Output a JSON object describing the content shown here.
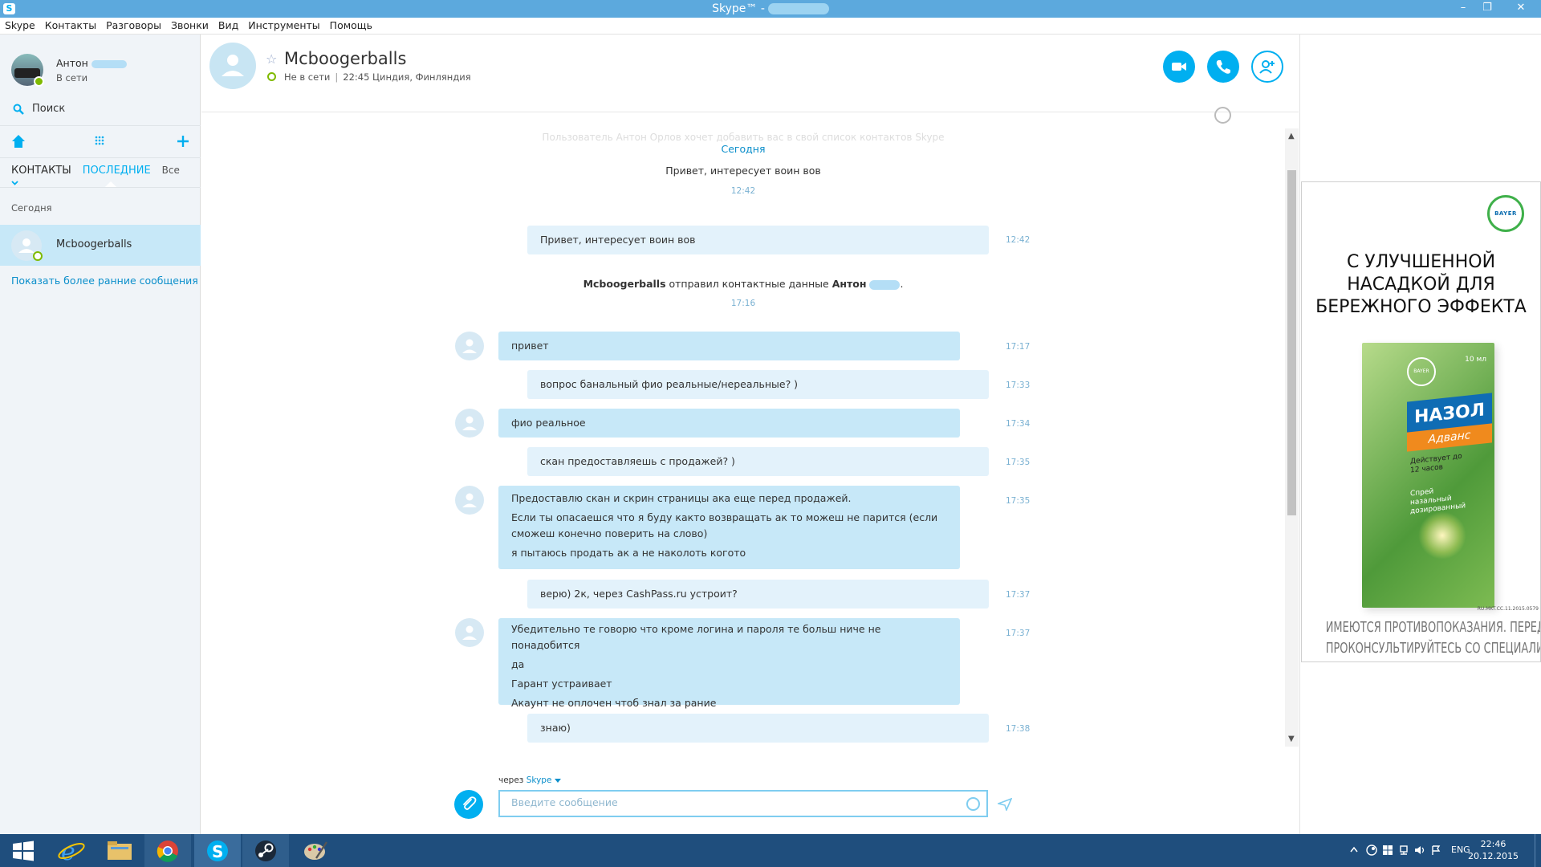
{
  "window": {
    "title": "Skype™ -",
    "app_icon": "skype-icon",
    "minimize": "–",
    "restore": "❐",
    "close": "✕"
  },
  "menu": [
    "Skype",
    "Контакты",
    "Разговоры",
    "Звонки",
    "Вид",
    "Инструменты",
    "Помощь"
  ],
  "profile": {
    "name": "Антон",
    "status": "В сети"
  },
  "search": {
    "label": "Поиск"
  },
  "tabs": {
    "contacts": "КОНТАКТЫ",
    "recent": "ПОСЛЕДНИЕ",
    "filter": "Все"
  },
  "recent": {
    "section": "Сегодня",
    "contact": "Mcboogerballs",
    "show_more": "Показать более ранние сообщения"
  },
  "conversation": {
    "title": "Mcboogerballs",
    "status": "Не в сети",
    "local_info": "22:45 Циндия, Финляндия",
    "faded_notice": "Пользователь Антон Орлов хочет добавить вас в свой список контактов Skype",
    "day": "Сегодня",
    "first_text": "Привет, интересует воин вов",
    "first_time": "12:42",
    "contact_notice": {
      "who": "Mcboogerballs",
      "text": " отправил контактные данные ",
      "contact": "Антон",
      "end": "."
    },
    "contact_time": "17:16",
    "messages": [
      {
        "dir": "out",
        "lines": [
          "Привет, интересует воин вов"
        ],
        "time": "12:42"
      },
      {
        "dir": "in",
        "lines": [
          "привет"
        ],
        "time": "17:17"
      },
      {
        "dir": "out",
        "lines": [
          "вопрос банальный фио реальные/нереальные? )"
        ],
        "time": "17:33"
      },
      {
        "dir": "in",
        "lines": [
          "фио реальное"
        ],
        "time": "17:34"
      },
      {
        "dir": "out",
        "lines": [
          "скан предоставляешь с продажей? )"
        ],
        "time": "17:35"
      },
      {
        "dir": "in",
        "lines": [
          "Предоставлю скан и скрин страницы ака еще перед продажей.",
          "Если ты опасаешся что я буду както возвращать ак то можеш не парится (если",
          "сможеш конечно поверить на слово)",
          "я пытаюсь продать ак а не наколоть когото"
        ],
        "time": "17:35"
      },
      {
        "dir": "out",
        "lines": [
          "верю) 2к, через CashPass.ru устроит?"
        ],
        "time": "17:37"
      },
      {
        "dir": "in",
        "lines": [
          "Убедительно те говорю что кроме логина и пароля те больш ниче не понадобится",
          "да",
          "Гарант устраивает",
          "Акаунт не оплочен чтоб знал за рание"
        ],
        "time": "17:37"
      },
      {
        "dir": "out",
        "lines": [
          "знаю)"
        ],
        "time": "17:38"
      }
    ]
  },
  "compose": {
    "via_prefix": "через",
    "via_service": "Skype",
    "placeholder": "Введите сообщение"
  },
  "ad": {
    "logo": "BAYER",
    "headline": [
      "С УЛУЧШЕННОЙ",
      "НАСАДКОЙ ДЛЯ",
      "БЕРЕЖНОГО ЭФФЕКТА"
    ],
    "product_logo": "BAYER",
    "volume": "10 мл",
    "brand": "НАЗОЛ",
    "sub": "Адванс",
    "claim": "Действует до 12 часов",
    "desc": "Спрей назальный дозированный",
    "code": "RU.MKT.CC.11.2015.0579",
    "footer": [
      "ИМЕЮТСЯ ПРОТИВОПОКАЗАНИЯ. ПЕРЕД ПРИМЕНЕНИЕМ",
      "ПРОКОНСУЛЬТИРУЙТЕСЬ СО СПЕЦИАЛИСТОМ"
    ]
  },
  "taskbar": {
    "lang": "ENG",
    "time": "22:46",
    "date": "20.12.2015",
    "apps": [
      "windows-start-icon",
      "internet-explorer-icon",
      "file-explorer-icon",
      "chrome-icon",
      "skype-icon",
      "steam-icon",
      "paint-icon"
    ]
  },
  "colors": {
    "accent": "#00aff0",
    "incoming": "#c7e8f8",
    "outgoing": "#e3f2fb",
    "titlebar": "#5ca9dd",
    "taskbar": "#1f4e7d",
    "online": "#7fba00"
  }
}
